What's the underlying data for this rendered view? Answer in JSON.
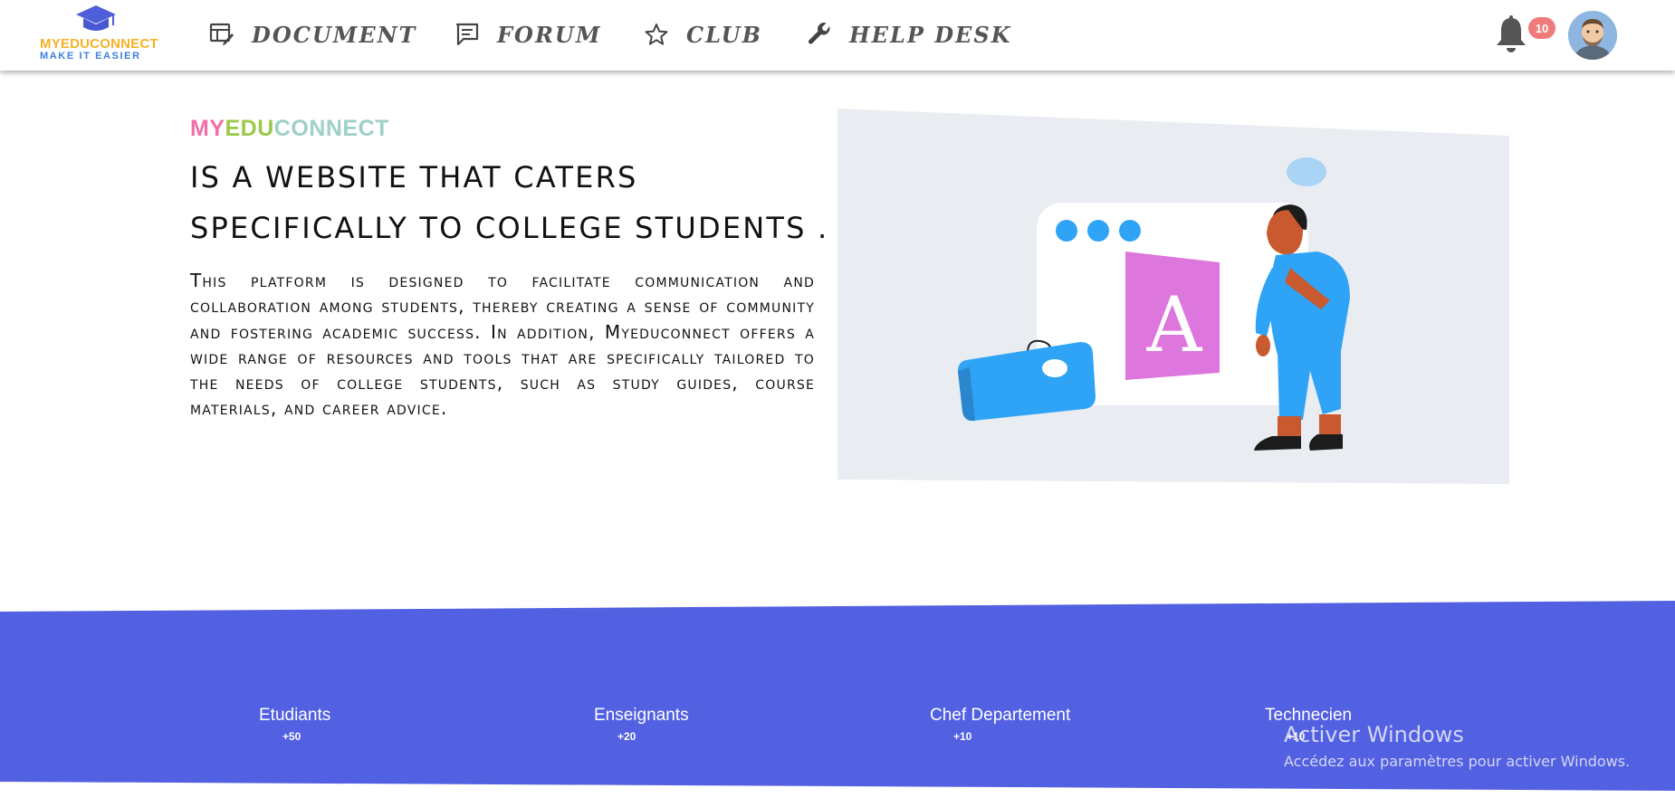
{
  "app": {
    "logo_line1": "MYEDUCONNECT",
    "logo_line2": "MAKE IT EASIER"
  },
  "nav": {
    "items": [
      {
        "label": "DOCUMENT",
        "icon": "document-edit-icon"
      },
      {
        "label": "FORUM",
        "icon": "chat-icon"
      },
      {
        "label": "CLUB",
        "icon": "star-icon"
      },
      {
        "label": "HELP DESK",
        "icon": "wrench-icon"
      }
    ],
    "notification_count": "10"
  },
  "hero": {
    "brand_my": "MY",
    "brand_edu": "EDU",
    "brand_connect": "CONNECT",
    "headline_line1": "IS A WEBSITE THAT CATERS",
    "headline_line2": "SPECIFICALLY TO COLLEGE STUDENTS .",
    "description": "This platform is designed to facilitate communication and collaboration among students, thereby creating a sense of community and fostering academic success. In addition, Myeduconnect offers a wide range of resources and tools that are specifically tailored to the needs of college students, such as study guides, course materials, and career advice.",
    "illustration_letter": "A"
  },
  "stats": [
    {
      "title": "Etudiants",
      "value": "+50"
    },
    {
      "title": "Enseignants",
      "value": "+20"
    },
    {
      "title": "Chef Departement",
      "value": "+10"
    },
    {
      "title": "Technecien",
      "value": "+10"
    }
  ],
  "watermark": {
    "line1": "Activer Windows",
    "line2": "Accédez aux paramètres pour activer Windows."
  },
  "colors": {
    "band": "#5260e2",
    "brand_my": "#f06fa9",
    "brand_edu": "#9bc94b",
    "brand_connect": "#9fd0c6",
    "logo_text": "#f5b225",
    "badge": "#f07b7b",
    "illustration_bg": "#e9edf1"
  }
}
